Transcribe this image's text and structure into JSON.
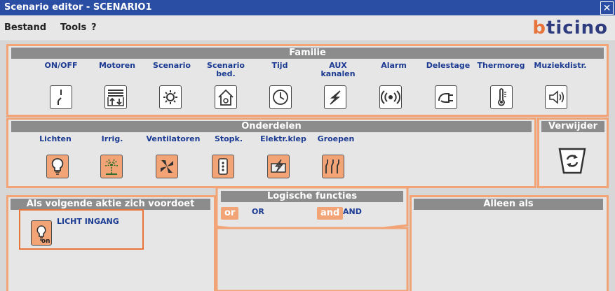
{
  "window": {
    "title": "Scenario editor - SCENARIO1",
    "close_glyph": "✕"
  },
  "menu": {
    "items": [
      "Bestand",
      "Tools",
      "?"
    ]
  },
  "brand": {
    "part1": "b",
    "part2": "ticino"
  },
  "familie": {
    "title": "Familie",
    "items": [
      {
        "label": "ON/OFF",
        "icon": "switch-icon"
      },
      {
        "label": "Motoren",
        "icon": "motor-shutter-icon"
      },
      {
        "label": "Scenario",
        "icon": "scenario-icon"
      },
      {
        "label": "Scenario bed.",
        "icon": "scenario-house-icon"
      },
      {
        "label": "Tijd",
        "icon": "clock-icon"
      },
      {
        "label": "AUX kanalen",
        "icon": "lightning-icon"
      },
      {
        "label": "Alarm",
        "icon": "alarm-icon"
      },
      {
        "label": "Delestage",
        "icon": "plug-icon"
      },
      {
        "label": "Thermoreg",
        "icon": "thermometer-icon"
      },
      {
        "label": "Muziekdistr.",
        "icon": "speaker-icon"
      }
    ]
  },
  "onderdelen": {
    "title": "Onderdelen",
    "items": [
      {
        "label": "Lichten",
        "icon": "lightbulb-icon"
      },
      {
        "label": "Irrig.",
        "icon": "irrigation-icon"
      },
      {
        "label": "Ventilatoren",
        "icon": "fan-icon"
      },
      {
        "label": "Stopk.",
        "icon": "socket-icon"
      },
      {
        "label": "Elektr.klep",
        "icon": "valve-icon"
      },
      {
        "label": "Groepen",
        "icon": "groups-icon"
      }
    ]
  },
  "verwijder": {
    "title": "Verwijder",
    "icon": "trash-recycle-icon"
  },
  "als": {
    "title": "Als volgende aktie zich voordoet",
    "item": {
      "label": "LICHT INGANG",
      "badge": "on",
      "icon": "lightbulb-icon"
    }
  },
  "logische": {
    "title": "Logische functies",
    "or_button": "or",
    "or_label": "OR",
    "and_button": "and",
    "and_label": "AND"
  },
  "alleen": {
    "title": "Alleen als"
  },
  "colors": {
    "accent": "#f2a477",
    "title_bar": "#2b4ea5",
    "label_blue": "#1b3a92",
    "section_bar": "#8c8c8c"
  }
}
